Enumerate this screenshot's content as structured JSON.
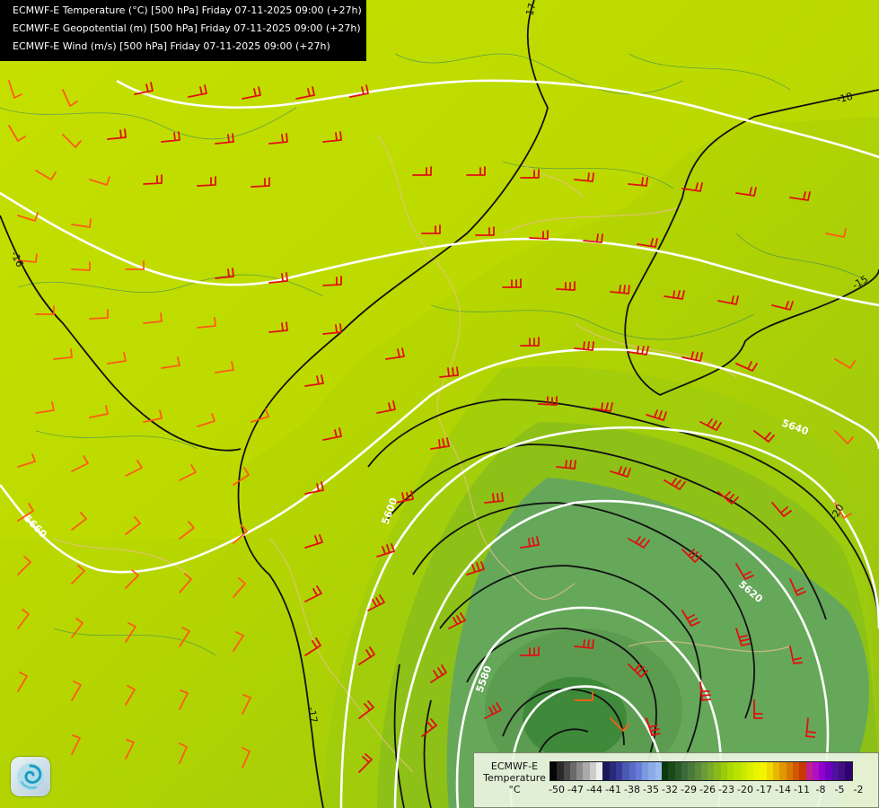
{
  "title_box": {
    "line1": "ECMWF-E Temperature (°C) [500 hPa] Friday 07-11-2025 09:00 (+27h)",
    "line2": "ECMWF-E Geopotential (m) [500 hPa] Friday 07-11-2025 09:00 (+27h)",
    "line3": "ECMWF-E Wind (m/s) [500 hPa] Friday 07-11-2025 09:00 (+27h)"
  },
  "contour_labels": {
    "temperature": [
      "-17",
      "-16",
      "-18",
      "-15",
      "-20",
      "-17"
    ],
    "geopotential": [
      "5660",
      "5600",
      "5640",
      "5620",
      "5580"
    ]
  },
  "legend": {
    "title_line1": "ECMWF-E",
    "title_line2": "Temperature",
    "title_line3": "°C",
    "ticks": [
      "-50",
      "-47",
      "-44",
      "-41",
      "-38",
      "-35",
      "-32",
      "-29",
      "-26",
      "-23",
      "-20",
      "-17",
      "-14",
      "-11",
      "-8",
      "-5",
      "-2"
    ],
    "colors": [
      "#050505",
      "#2a2a2a",
      "#4a4a4a",
      "#6a6a6a",
      "#8a8a8a",
      "#aaaaaa",
      "#cccccc",
      "#eeeeee",
      "#1a1a5a",
      "#2a2a7a",
      "#3a3a9a",
      "#4a5ab0",
      "#5a6ac8",
      "#6a7ad8",
      "#7a9ae0",
      "#8aaae8",
      "#9abaf0",
      "#0a3a0a",
      "#1a4a1a",
      "#2a5a2a",
      "#3a6a3a",
      "#4a7a3a",
      "#5a8a3a",
      "#6a9a3a",
      "#7aaa2a",
      "#8aba1a",
      "#9aca0a",
      "#aada00",
      "#bae200",
      "#cae800",
      "#daee00",
      "#eaf400",
      "#f4f400",
      "#f0d800",
      "#e8b800",
      "#e09800",
      "#d87800",
      "#d05800",
      "#c83800",
      "#c02090",
      "#b010c0",
      "#9000d0",
      "#7000c0",
      "#5010a0",
      "#401080",
      "#300070"
    ]
  }
}
